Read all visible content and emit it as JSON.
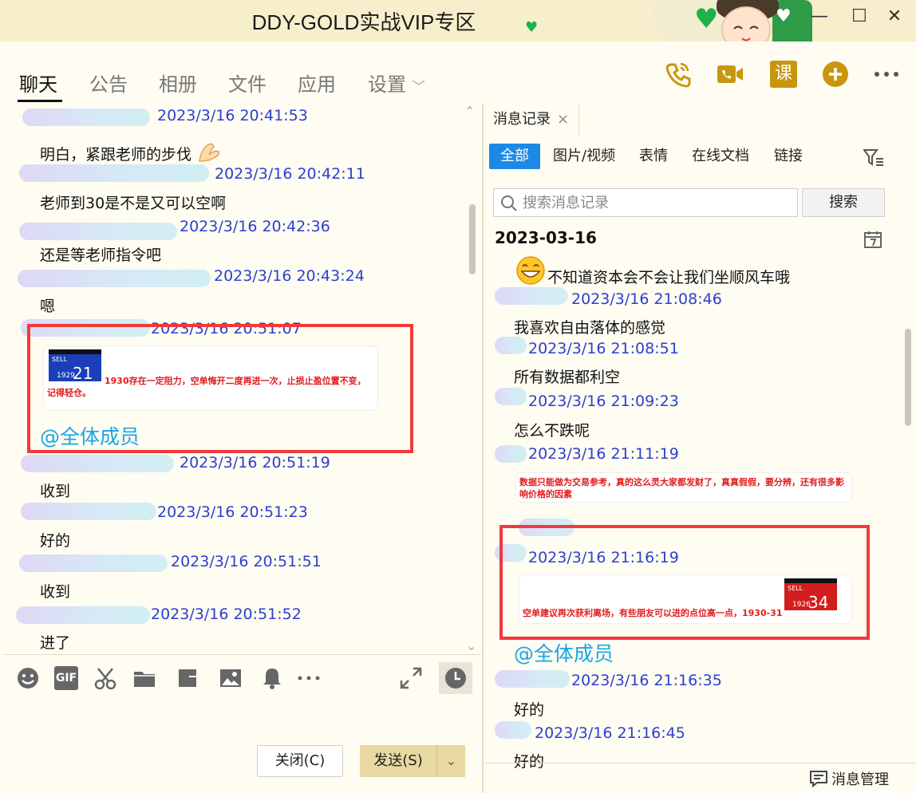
{
  "window": {
    "title": "DDY-GOLD实战VIP专区",
    "controls": {
      "min": "—",
      "max": "☐",
      "close": "✕"
    },
    "skin_label": "饭团"
  },
  "tabs": [
    {
      "label": "聊天"
    },
    {
      "label": "公告"
    },
    {
      "label": "相册"
    },
    {
      "label": "文件"
    },
    {
      "label": "应用"
    },
    {
      "label": "设置"
    }
  ],
  "top_icons": {
    "course_label": "课"
  },
  "chat": {
    "messages": [
      {
        "time": "2023/3/16 20:41:53",
        "text": "明白，紧跟老师的步伐"
      },
      {
        "time": "2023/3/16 20:42:11",
        "text": "老师到30是不是又可以空啊"
      },
      {
        "time": "2023/3/16 20:42:36",
        "text": "还是等老师指令吧"
      },
      {
        "time": "2023/3/16 20:43:24",
        "text": "嗯"
      },
      {
        "time": "2023/3/16 20:51:07",
        "text": ""
      },
      {
        "time": "2023/3/16 20:51:19",
        "text": "收到"
      },
      {
        "time": "2023/3/16 20:51:23",
        "text": "好的"
      },
      {
        "time": "2023/3/16 20:51:51",
        "text": "收到"
      },
      {
        "time": "2023/3/16 20:51:52",
        "text": "进了"
      }
    ],
    "signal": {
      "sell_label": "SELL",
      "small_price": "1929",
      "big_price": "21",
      "text": "1930存在一定阻力，空单悔开二度再进一次，止损止盈位置不变，记得轻仓。",
      "mention": "@全体成员"
    }
  },
  "buttons": {
    "close": "关闭(C)",
    "send": "发送(S)",
    "send_arrow": "⌄"
  },
  "history": {
    "tab_label": "消息记录",
    "tab_close": "×",
    "filters": [
      {
        "label": "全部"
      },
      {
        "label": "图片/视频"
      },
      {
        "label": "表情"
      },
      {
        "label": "在线文档"
      },
      {
        "label": "链接"
      }
    ],
    "search_placeholder": "搜索消息记录",
    "search_button": "搜索",
    "date": "2023-03-16",
    "messages": [
      {
        "time": "",
        "text": "不知道资本会不会让我们坐顺风车哦"
      },
      {
        "time": "2023/3/16 21:08:46",
        "text": "我喜欢自由落体的感觉"
      },
      {
        "time": "2023/3/16 21:08:51",
        "text": "所有数据都利空"
      },
      {
        "time": "2023/3/16 21:09:23",
        "text": "怎么不跌呢"
      },
      {
        "time": "2023/3/16 21:11:19",
        "text": ""
      },
      {
        "time": "2023/3/16 21:16:19",
        "text": ""
      },
      {
        "time": "2023/3/16 21:16:35",
        "text": "好的"
      },
      {
        "time": "2023/3/16 21:16:45",
        "text": "好的"
      }
    ],
    "notice_text": "数据只能做为交易参考，真的这么灵大家都发财了，真真假假，要分辨，还有很多影响价格的因素",
    "signal": {
      "sell_label": "SELL",
      "small_price": "1926",
      "big_price": "34",
      "text": "空单建议再次获利离场，有些朋友可以进的点位高一点，1930-31",
      "mention": "@全体成员"
    },
    "footer_label": "消息管理"
  },
  "colors": {
    "timestamp": "#2b3fd1",
    "mention": "#1aa5e8",
    "alert": "#e21b1b",
    "accent": "#1e88e5",
    "highlight_box": "#ef3b3b"
  }
}
